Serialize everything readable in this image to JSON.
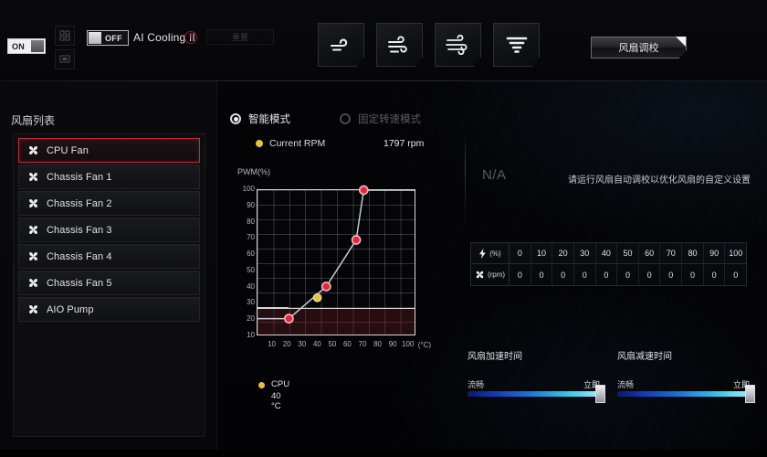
{
  "header": {
    "power_toggle": {
      "state": "ON",
      "name": "power-toggle"
    },
    "ai_cooling_toggle": {
      "state": "OFF"
    },
    "ai_cooling_label": "AI Cooling II",
    "warn_icon_glyph": "!",
    "reset_button": "重置",
    "presets": [
      {
        "label": "",
        "icon": "wind-light-icon"
      },
      {
        "label": "",
        "icon": "wind-medium-icon"
      },
      {
        "label": "",
        "icon": "wind-strong-icon"
      },
      {
        "label": "",
        "icon": "turbo-fan-icon"
      }
    ],
    "fan_tuning_button": "风扇调校"
  },
  "sidebar": {
    "title": "风扇列表",
    "items": [
      {
        "label": "CPU Fan",
        "selected": true
      },
      {
        "label": "Chassis Fan 1",
        "selected": false
      },
      {
        "label": "Chassis Fan 2",
        "selected": false
      },
      {
        "label": "Chassis Fan 3",
        "selected": false
      },
      {
        "label": "Chassis Fan 4",
        "selected": false
      },
      {
        "label": "Chassis Fan 5",
        "selected": false
      },
      {
        "label": "AIO Pump",
        "selected": false
      }
    ]
  },
  "main": {
    "mode_smart": "智能模式",
    "mode_fixed": "固定转速模式",
    "selected_mode": "智能模式",
    "current_rpm_label": "Current RPM",
    "current_rpm_value": "1797 rpm",
    "cpu_legend_name": "CPU",
    "cpu_legend_temp": "40 °C"
  },
  "right": {
    "na_text": "N/A",
    "hint_text": "请运行风扇自动调校以优化风扇的自定义设置",
    "table": {
      "row_pwm_unit": "(%)",
      "row_rpm_unit": "(rpm)",
      "pwm_values": [
        "0",
        "10",
        "20",
        "30",
        "40",
        "50",
        "60",
        "70",
        "80",
        "90",
        "100"
      ],
      "rpm_values": [
        "0",
        "0",
        "0",
        "0",
        "0",
        "0",
        "0",
        "0",
        "0",
        "0",
        "0"
      ]
    },
    "slider_up": {
      "title": "风扇加速时间",
      "left_label": "流畅",
      "right_label": "立即",
      "value": 100
    },
    "slider_down": {
      "title": "风扇减速时间",
      "left_label": "流畅",
      "right_label": "立即",
      "value": 100
    }
  },
  "colors": {
    "accent_red": "#c22a3d",
    "point_red": "#e8253f",
    "point_yellow": "#e6c23c",
    "slider_cyan": "#35c8e8"
  },
  "chart_data": {
    "type": "line",
    "title": "",
    "xlabel": "(°C)",
    "ylabel": "PWM(%)",
    "xlim": [
      0,
      105
    ],
    "ylim": [
      10,
      100
    ],
    "grid": true,
    "xticks": [
      10,
      20,
      30,
      40,
      50,
      60,
      70,
      80,
      90,
      100
    ],
    "yticks": [
      10,
      20,
      30,
      40,
      50,
      60,
      70,
      80,
      90,
      100
    ],
    "series": [
      {
        "name": "CPU Fan curve",
        "color": "#e8253f",
        "x": [
          21,
          46,
          66,
          71
        ],
        "y": [
          20,
          40,
          69,
          100
        ]
      }
    ],
    "current_point": {
      "name": "CPU",
      "x": 40,
      "y": 33,
      "color": "#e6c23c"
    },
    "floor_level": 20,
    "annotations": []
  }
}
